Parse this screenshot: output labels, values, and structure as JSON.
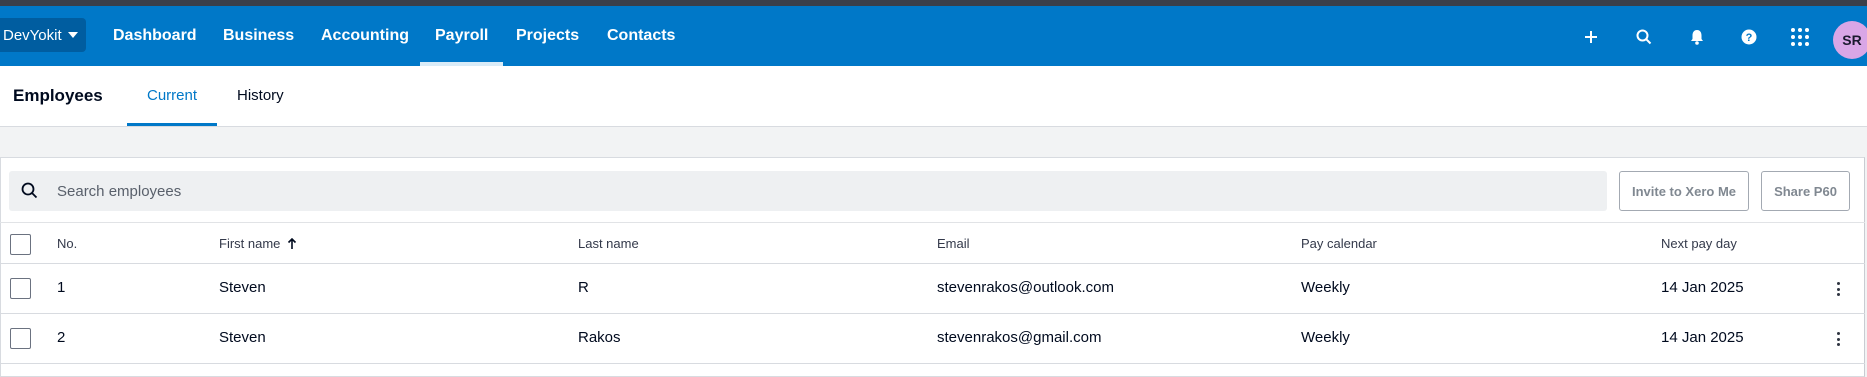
{
  "nav": {
    "org_name": "DevYokit",
    "items": [
      {
        "label": "Dashboard",
        "active": false
      },
      {
        "label": "Business",
        "active": false
      },
      {
        "label": "Accounting",
        "active": false
      },
      {
        "label": "Payroll",
        "active": true
      },
      {
        "label": "Projects",
        "active": false
      },
      {
        "label": "Contacts",
        "active": false
      }
    ],
    "icons": [
      "plus-icon",
      "search-icon",
      "bell-icon",
      "help-icon",
      "apps-grid-icon"
    ],
    "avatar_initials": "SR"
  },
  "page": {
    "title": "Employees",
    "tabs": [
      {
        "label": "Current",
        "active": true
      },
      {
        "label": "History",
        "active": false
      }
    ]
  },
  "toolbar": {
    "search_placeholder": "Search employees",
    "invite_label": "Invite to Xero Me",
    "share_label": "Share P60"
  },
  "table": {
    "columns": [
      "No.",
      "First name",
      "Last name",
      "Email",
      "Pay calendar",
      "Next pay day"
    ],
    "sort": {
      "column": "First name",
      "direction": "ascending"
    },
    "rows": [
      {
        "no": "1",
        "first_name": "Steven",
        "last_name": "R",
        "email": "stevenrakos@outlook.com",
        "pay_calendar": "Weekly",
        "next_pay_day": "14 Jan 2025"
      },
      {
        "no": "2",
        "first_name": "Steven",
        "last_name": "Rakos",
        "email": "stevenrakos@gmail.com",
        "pay_calendar": "Weekly",
        "next_pay_day": "14 Jan 2025"
      }
    ]
  },
  "colors": {
    "brand_blue": "#0078c8",
    "org_switch_bg": "#005da0",
    "avatar_bg": "#d9a6e6"
  }
}
